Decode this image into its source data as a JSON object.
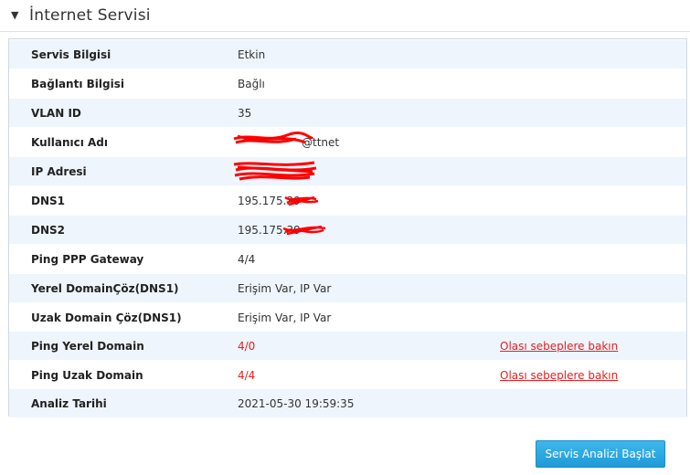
{
  "section": {
    "title": "İnternet Servisi",
    "toggle_icon": "triangle-down-icon"
  },
  "rows": [
    {
      "label": "Servis Bilgisi",
      "value": "Etkin"
    },
    {
      "label": "Bağlantı Bilgisi",
      "value": "Bağlı"
    },
    {
      "label": "VLAN ID",
      "value": "35"
    },
    {
      "label": "Kullanıcı Adı",
      "value": "@ttnet"
    },
    {
      "label": "IP Adresi",
      "value": ""
    },
    {
      "label": "DNS1",
      "value": "195.175.39"
    },
    {
      "label": "DNS2",
      "value": "195.175.39"
    },
    {
      "label": "Ping PPP Gateway",
      "value": "4/4"
    },
    {
      "label": "Yerel DomainÇöz(DNS1)",
      "value": "Erişim Var, IP Var"
    },
    {
      "label": "Uzak Domain Çöz(DNS1)",
      "value": "Erişim Var, IP Var"
    },
    {
      "label": "Ping Yerel Domain",
      "value": "4/0",
      "link": "Olası sebeplere bakın"
    },
    {
      "label": "Ping Uzak Domain",
      "value": "4/4",
      "link": "Olası sebeplere bakın"
    },
    {
      "label": "Analiz Tarihi",
      "value": "2021-05-30 19:59:35"
    }
  ],
  "button": {
    "label": "Servis Analizi Başlat"
  },
  "colors": {
    "accent": "#1f9bd8",
    "alert": "#e81e1e",
    "row_alt": "#eef5fd"
  }
}
